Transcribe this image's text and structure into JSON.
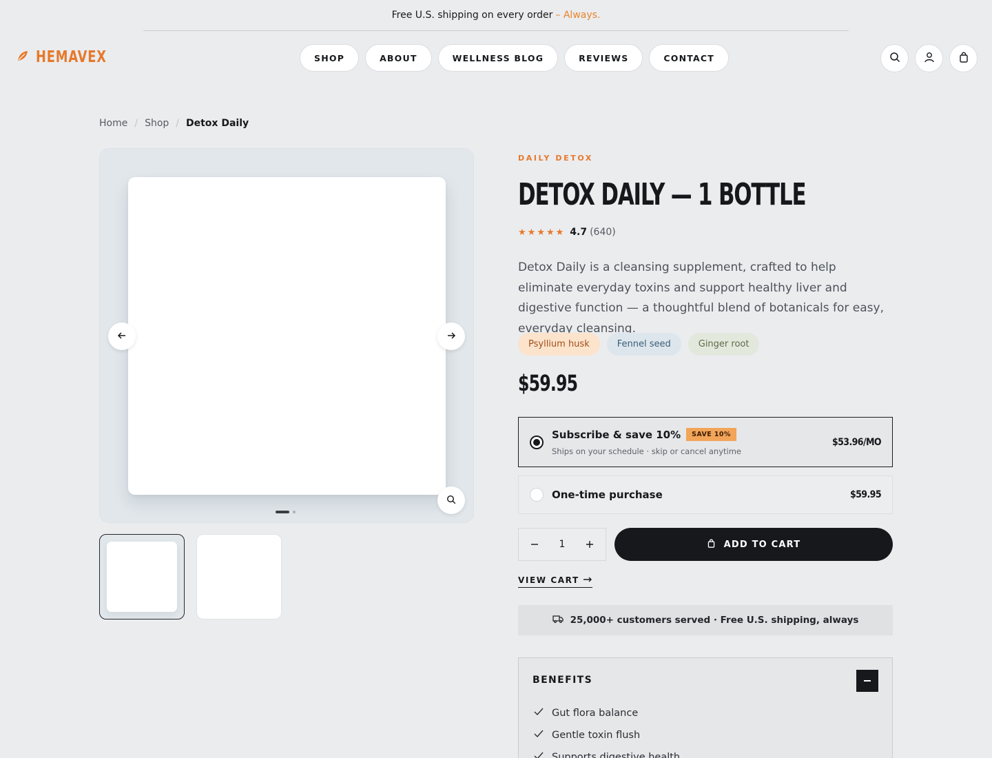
{
  "announcement": {
    "text": "Free U.S. shipping on every order",
    "accent": "– Always."
  },
  "brand": {
    "name": "HEMAVEX",
    "icon": "leaf-icon",
    "color": "#e6792b"
  },
  "nav": [
    "SHOP",
    "ABOUT",
    "WELLNESS BLOG",
    "REVIEWS",
    "CONTACT"
  ],
  "header_icons": [
    "search-icon",
    "user-icon",
    "bag-icon"
  ],
  "breadcrumb": {
    "home": "Home",
    "shop": "Shop",
    "current": "Detox Daily"
  },
  "gallery": {
    "slides": 2,
    "active_slide": 1,
    "thumbnails": 2
  },
  "product": {
    "eyebrow": "DAILY DETOX",
    "title": "DETOX DAILY — 1 BOTTLE",
    "rating": {
      "score": "4.7",
      "count": "(640)",
      "stars": 5
    },
    "description": "Detox Daily is a cleansing supplement, crafted to help eliminate everyday toxins and support healthy liver and digestive function — a thoughtful blend of botanicals for easy, everyday cleansing.",
    "tags": [
      "Psyllium husk",
      "Fennel seed",
      "Ginger root"
    ],
    "price": "$59.95"
  },
  "purchase": {
    "subscribe": {
      "title": "Subscribe & save 10%",
      "badge": "SAVE 10%",
      "subtitle": "Ships on your schedule · skip or cancel anytime",
      "price": "$53.96/MO",
      "selected": true
    },
    "one_time": {
      "title": "One-time purchase",
      "price": "$59.95",
      "selected": false
    },
    "quantity": "1",
    "add_to_cart": "ADD TO CART",
    "view_cart": "VIEW CART"
  },
  "trust": {
    "text": "25,000+ customers served · Free U.S. shipping, always",
    "icon": "truck-icon"
  },
  "benefits": {
    "heading": "BENEFITS",
    "items": [
      "Gut flora balance",
      "Gentle toxin flush",
      "Supports digestive health"
    ]
  }
}
